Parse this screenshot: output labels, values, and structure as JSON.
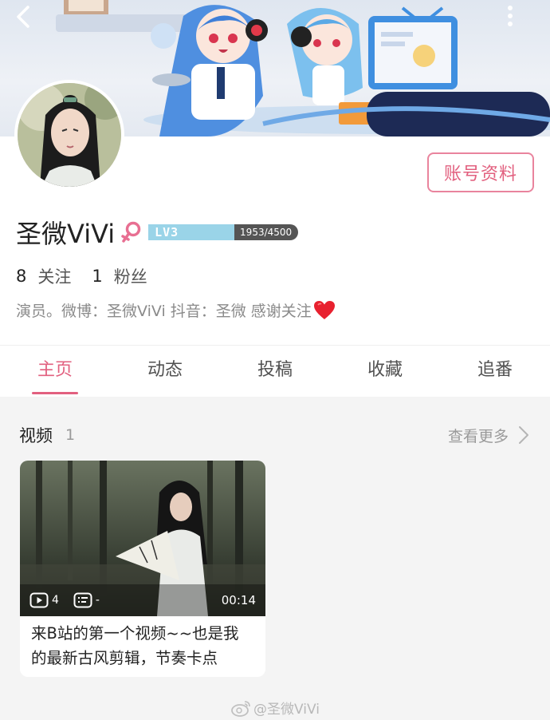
{
  "header": {
    "back_icon": "chevron-left-icon",
    "more_icon": "more-vertical-icon"
  },
  "profile": {
    "account_button": "账号资料",
    "name": "圣微ViVi",
    "gender_icon": "female-icon",
    "level": "LV3",
    "exp_text": "1953/4500",
    "exp_current": 1953,
    "exp_total": 4500,
    "following_count": "8",
    "following_label": "关注",
    "followers_count": "1",
    "followers_label": "粉丝",
    "bio": "演员。微博：圣微ViVi 抖音：圣微 感谢关注",
    "bio_emoji": "red-heart-icon"
  },
  "tabs": [
    {
      "label": "主页",
      "active": true
    },
    {
      "label": "动态",
      "active": false
    },
    {
      "label": "投稿",
      "active": false
    },
    {
      "label": "收藏",
      "active": false
    },
    {
      "label": "追番",
      "active": false
    }
  ],
  "videos_section": {
    "title": "视频",
    "count": "1",
    "see_more": "查看更多"
  },
  "video_card": {
    "plays": "4",
    "danmaku": "-",
    "duration": "00:14",
    "title": "来B站的第一个视频~~也是我的最新古风剪辑，节奏卡点"
  },
  "watermark": "@圣微ViVi",
  "colors": {
    "accent": "#e2607f",
    "level": "#9ad4e8"
  }
}
